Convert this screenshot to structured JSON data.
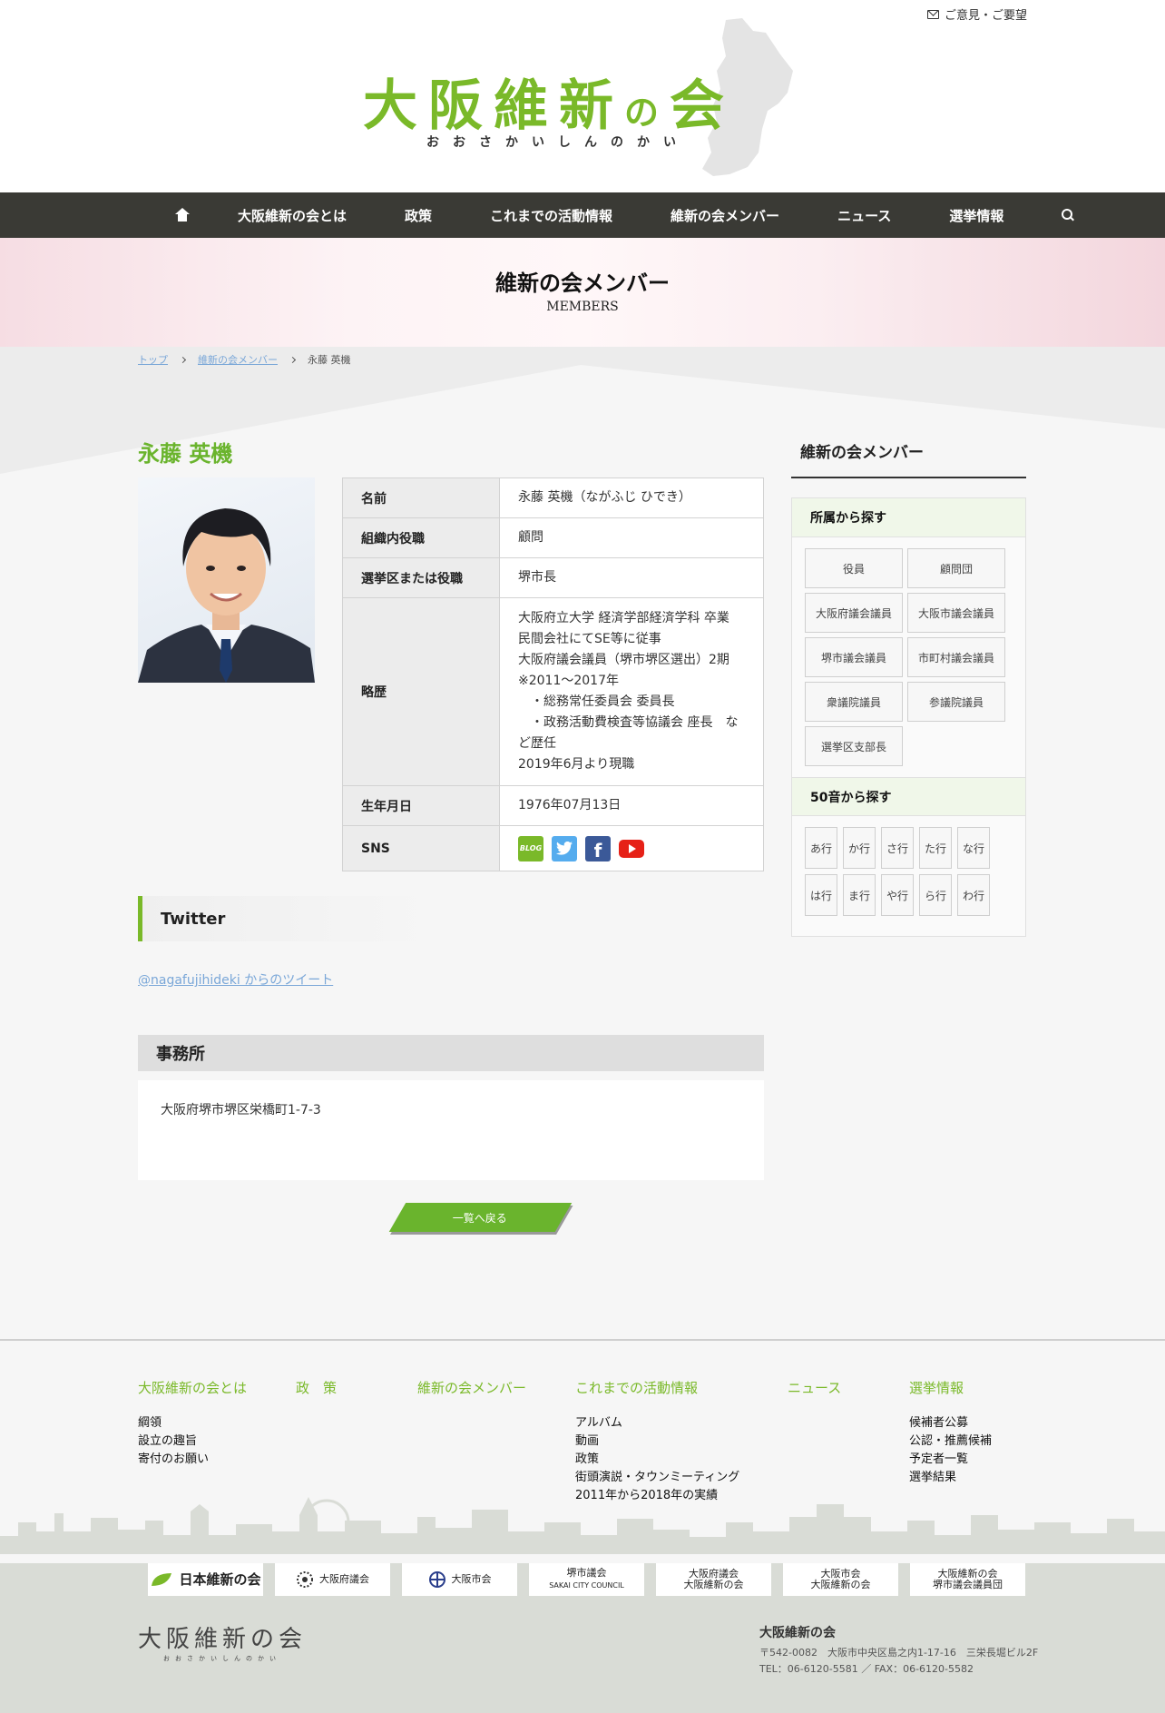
{
  "header": {
    "top_link": "ご意見・ご要望",
    "logo_main": "大阪維新",
    "logo_no": "の",
    "logo_kai": "会",
    "logo_kana": "おおさかいしんのかい"
  },
  "nav": {
    "items": [
      "大阪維新の会とは",
      "政策",
      "これまでの活動情報",
      "維新の会メンバー",
      "ニュース",
      "選挙情報"
    ]
  },
  "banner": {
    "title": "維新の会メンバー",
    "subtitle": "MEMBERS"
  },
  "breadcrumb": [
    "トップ",
    "維新の会メンバー",
    "永藤 英機"
  ],
  "member": {
    "name": "永藤 英機",
    "table": [
      {
        "label": "名前",
        "value": "永藤 英機（ながふじ ひでき）"
      },
      {
        "label": "組織内役職",
        "value": "顧問"
      },
      {
        "label": "選挙区または役職",
        "value": "堺市長"
      },
      {
        "label": "略歴",
        "lines": [
          "大阪府立大学 経済学部経済学科 卒業",
          "民間会社にてSE等に従事",
          "大阪府議会議員（堺市堺区選出）2期",
          "※2011～2017年",
          "　・総務常任委員会 委員長",
          "　・政務活動費検査等協議会 座長　など歴任",
          "2019年6月より現職"
        ]
      },
      {
        "label": "生年月日",
        "value": "1976年07月13日"
      },
      {
        "label": "SNS"
      }
    ],
    "sns": {
      "blog": "BLOG",
      "facebook": "f"
    }
  },
  "twitter": {
    "heading": "Twitter",
    "link": "@nagafujihideki からのツイート"
  },
  "office": {
    "heading": "事務所",
    "address": "大阪府堺市堺区栄橋町1-7-3"
  },
  "back_button": "一覧へ戻る",
  "sidebar": {
    "title": "維新の会メンバー",
    "affiliation_title": "所属から探す",
    "affiliations": [
      "役員",
      "顧問団",
      "大阪府議会議員",
      "大阪市議会議員",
      "堺市議会議員",
      "市町村議会議員",
      "衆議院議員",
      "参議院議員",
      "選挙区支部長"
    ],
    "kana_title": "50音から探す",
    "kana": [
      "あ行",
      "か行",
      "さ行",
      "た行",
      "な行",
      "は行",
      "ま行",
      "や行",
      "ら行",
      "わ行"
    ]
  },
  "footer": {
    "cols": [
      {
        "head": "大阪維新の会とは",
        "items": [
          "綱領",
          "設立の趣旨",
          "寄付のお願い"
        ]
      },
      {
        "head": "政　策",
        "items": []
      },
      {
        "head": "維新の会メンバー",
        "items": []
      },
      {
        "head": "これまでの活動情報",
        "items": [
          "アルバム",
          "動画",
          "政策",
          "街頭演説・タウンミーティング",
          "2011年から2018年の実績"
        ]
      },
      {
        "head": "ニュース",
        "items": []
      },
      {
        "head": "選挙情報",
        "items": [
          "候補者公募",
          "公認・推薦候補",
          "予定者一覧",
          "選挙結果"
        ]
      }
    ],
    "logos": [
      {
        "text": "日本維新の会"
      },
      {
        "text": "大阪府議会"
      },
      {
        "text": "大阪市会"
      },
      {
        "line1": "堺市議会",
        "line2": "SAKAI CITY COUNCIL"
      },
      {
        "line1": "大阪府議会",
        "line2": "大阪維新の会"
      },
      {
        "line1": "大阪市会",
        "line2": "大阪維新の会"
      },
      {
        "line1": "大阪維新の会",
        "line2": "堺市議会議員団"
      }
    ],
    "logo_text": "大阪維新の会",
    "logo_kana": "おおさかいしんのかい",
    "org": "大阪維新の会",
    "address": "〒542-0082　大阪市中央区島之内1-17-16　三栄長堀ビル2F",
    "tel": "TEL：06-6120-5581 ／ FAX：06-6120-5582"
  },
  "colors": {
    "brand_green": "#7ab929",
    "nav_bg": "#3a3a35",
    "link_blue": "#7aa7d8"
  }
}
